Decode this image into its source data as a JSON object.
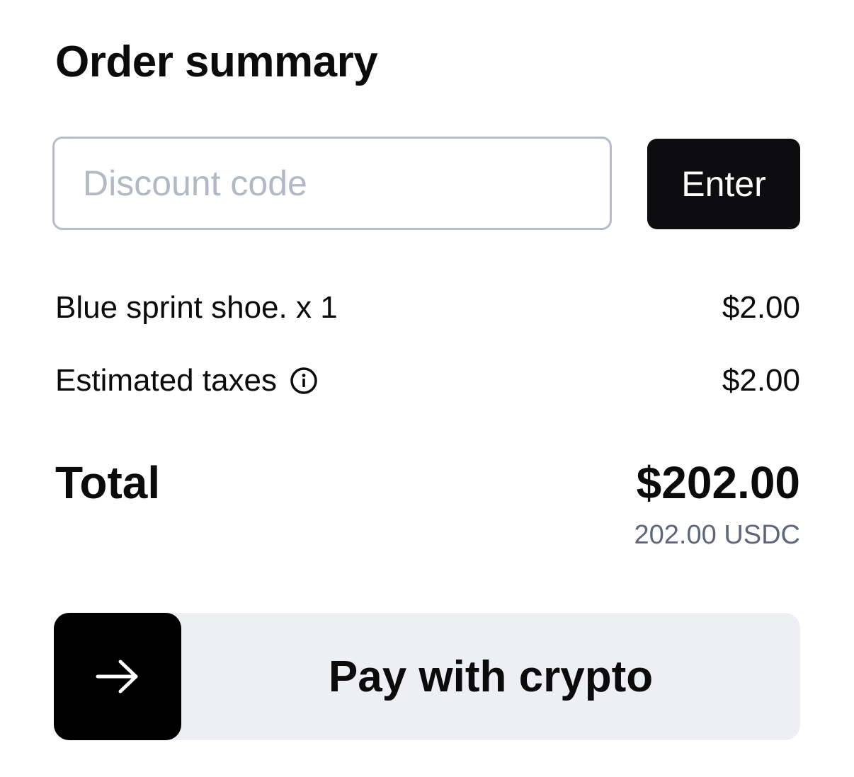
{
  "order_summary": {
    "title": "Order summary"
  },
  "discount": {
    "placeholder": "Discount code",
    "value": "",
    "button_label": "Enter"
  },
  "line_items": [
    {
      "label": "Blue sprint shoe. x 1",
      "amount": "$2.00"
    },
    {
      "label": "Estimated taxes",
      "amount": "$2.00",
      "icon": "info-icon"
    }
  ],
  "total": {
    "label": "Total",
    "amount": "$202.00",
    "crypto_amount": "202.00 USDC"
  },
  "pay": {
    "label": "Pay with crypto",
    "icon": "arrow-right-icon"
  },
  "colors": {
    "primary_dark": "#0d0d0f",
    "input_border": "#b7bcc8",
    "placeholder": "#b3b8c5",
    "muted_text": "#5f6679",
    "pay_background": "#eeeff3"
  }
}
